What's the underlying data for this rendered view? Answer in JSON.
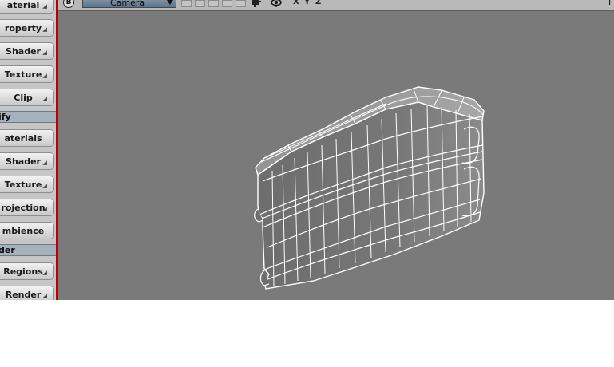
{
  "left_panel": {
    "items": [
      {
        "type": "button",
        "label": "aterial",
        "dropdown": true
      },
      {
        "type": "button",
        "label": "roperty",
        "dropdown": true
      },
      {
        "type": "button",
        "label": "Shader",
        "dropdown": true
      },
      {
        "type": "button",
        "label": "Texture",
        "dropdown": true
      },
      {
        "type": "button",
        "label": "Clip",
        "dropdown": true
      },
      {
        "type": "section",
        "label": "ify"
      },
      {
        "type": "button",
        "label": "aterials",
        "dropdown": false
      },
      {
        "type": "button",
        "label": "Shader",
        "dropdown": true
      },
      {
        "type": "button",
        "label": "Texture",
        "dropdown": true
      },
      {
        "type": "button",
        "label": "rojection",
        "dropdown": true
      },
      {
        "type": "button",
        "label": "mbience",
        "dropdown": false
      },
      {
        "type": "section",
        "label": "der"
      },
      {
        "type": "button",
        "label": "Regions",
        "dropdown": true
      },
      {
        "type": "button",
        "label": "Render",
        "dropdown": true
      }
    ]
  },
  "toolbar": {
    "viewport_letter": "B",
    "camera_label": "Camera",
    "axis_x": "X",
    "axis_y": "Y",
    "axis_z": "Z",
    "right_label": "T"
  },
  "icons": {
    "camera_dropdown_arrow": "triangle-down-icon",
    "display_icon": "display-icon",
    "eye_icon": "eye-icon"
  },
  "colors": {
    "viewport_bg": "#7a7a7a",
    "panel_bg": "#c6c6c6",
    "selection_blue": "#6e8497",
    "red_divider": "#c00000"
  }
}
